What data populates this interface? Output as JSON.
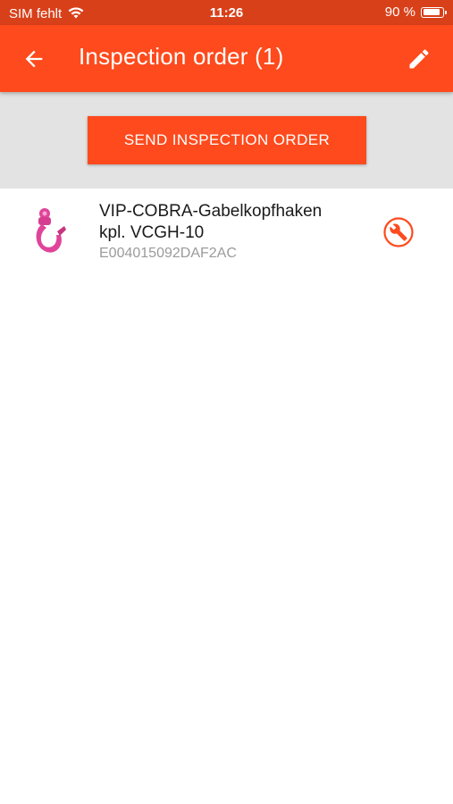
{
  "status_bar": {
    "carrier": "SIM fehlt",
    "time": "11:26",
    "battery": "90 %",
    "battery_level": 0.9
  },
  "app_bar": {
    "back_icon": "arrow-back-icon",
    "title": "Inspection order (1)",
    "edit_icon": "pencil-icon"
  },
  "actions": {
    "send_label": "SEND INSPECTION ORDER"
  },
  "items": [
    {
      "name_line1": "VIP-COBRA-Gabelkopfhaken",
      "name_line2": "kpl. VCGH-10",
      "id": "E004015092DAF2AC",
      "thumbnail_icon": "hook-product-icon",
      "action_icon": "wrench-icon"
    }
  ],
  "colors": {
    "accent": "#fe4a1c",
    "status_bar": "#d8401a",
    "action_area": "#e3e3e3",
    "product": "#e0449a"
  }
}
